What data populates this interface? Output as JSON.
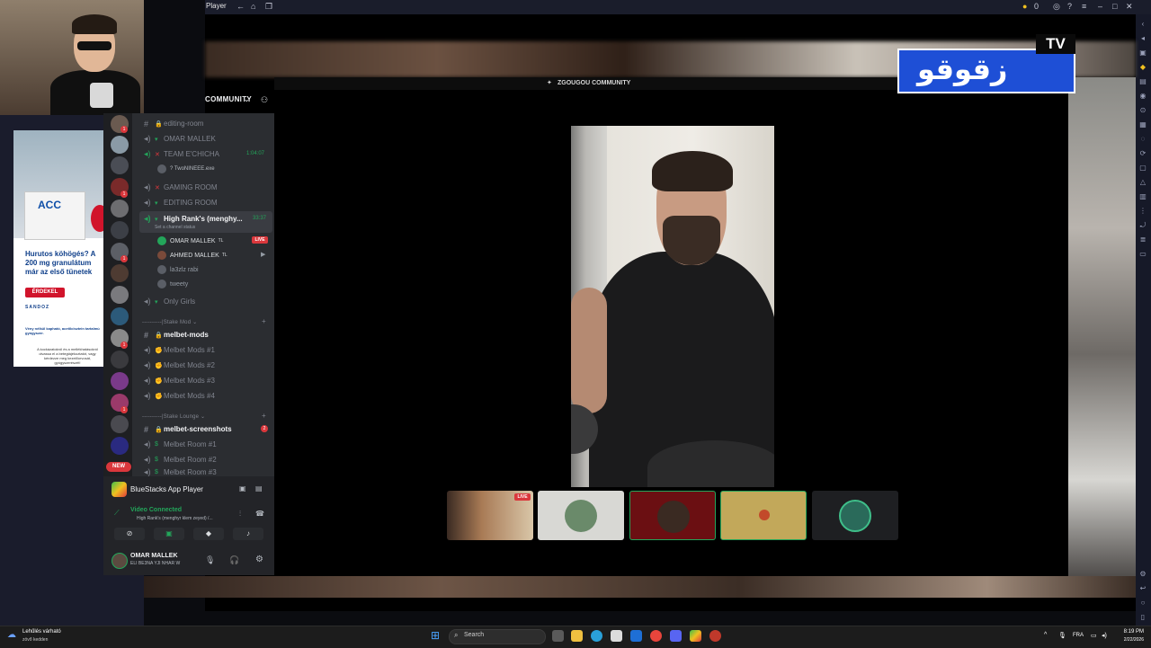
{
  "bluestacks": {
    "title": "Player",
    "coins": "0",
    "app_player_label": "BlueStacks App Player"
  },
  "channel_logo": {
    "text": "زقوقو",
    "tv": "TV"
  },
  "discord": {
    "server_name": "COMMUNITY",
    "stream_title": "ZGOUGOU COMMUNITY",
    "channels": [
      {
        "name": "editing-room",
        "type": "text",
        "bright": false
      },
      {
        "name": "OMAR MALLEK",
        "type": "voice",
        "bright": false
      },
      {
        "name": "TEAM E'CHICHA",
        "type": "voice",
        "bright": false,
        "timer": "1:04:07"
      },
      {
        "name": "GAMING ROOM",
        "type": "voice",
        "bright": false
      },
      {
        "name": "EDITING ROOM",
        "type": "voice",
        "bright": false
      },
      {
        "name": "High Rank's (menghy...",
        "type": "voice",
        "bright": true,
        "timer": "33:37"
      },
      {
        "name": "Only Girls",
        "type": "voice",
        "bright": false
      },
      {
        "name": "melbet-mods",
        "type": "text",
        "bright": true
      },
      {
        "name": "Melbet Mods #1",
        "type": "voice",
        "bright": false
      },
      {
        "name": "Melbet Mods #2",
        "type": "voice",
        "bright": false
      },
      {
        "name": "Melbet Mods #3",
        "type": "voice",
        "bright": false
      },
      {
        "name": "Melbet Mods #4",
        "type": "voice",
        "bright": false
      },
      {
        "name": "melbet-screenshots",
        "type": "text",
        "bright": true,
        "badge": "2"
      },
      {
        "name": "Melbet Room #1",
        "type": "voice",
        "bright": false
      },
      {
        "name": "Melbet Room #2",
        "type": "voice",
        "bright": false
      },
      {
        "name": "Melbet Room #3",
        "type": "voice",
        "bright": false
      }
    ],
    "team_user": "? TwoNINEEE.exe",
    "set_status": "Set a channel status",
    "voice_users": [
      {
        "name": "OMAR MALLEK",
        "tag": "TL",
        "live": "LIVE"
      },
      {
        "name": "AHMED MALLEK",
        "tag": "TL"
      },
      {
        "name": "la3zlz rabi"
      },
      {
        "name": "tweety"
      }
    ],
    "categories": [
      "Stake Mod",
      "Stake Lounge"
    ],
    "new_badge": "NEW",
    "voice_panel": {
      "status": "Video Connected",
      "channel": "High Rank's (menghyr klem zeyed) /..."
    },
    "user": {
      "name": "OMAR MALLEK",
      "status": "ELI BE3NA YJI NHAR W"
    }
  },
  "ad": {
    "product": "ACC",
    "headline": "Hurutos köhögés? A 200 mg granulátum már az első tünetek",
    "button": "ÉRDEKEL",
    "brand": "SANDOZ",
    "warning": "Vény nélkül kapható, acetilcisztein tartalmú gyógyszer.",
    "footer": "A kockázatokról és a mellékhatásokról olvassa el a betegtájékoztatót, vagy kérdezze meg kezelőorvosát, gyógyszerészét!"
  },
  "taskbar": {
    "weather_line1": "Lehűlés várható",
    "weather_line2": "zövő kedden",
    "search": "Search",
    "lang": "FRA",
    "time": "8:19 PM",
    "date": "2/22/2026"
  },
  "colors": {
    "discord_dark": "#1e1f22",
    "discord_sidebar": "#2b2d31",
    "live_red": "#da373c",
    "connected_green": "#23a55a",
    "logo_blue": "#1e4fd6"
  }
}
